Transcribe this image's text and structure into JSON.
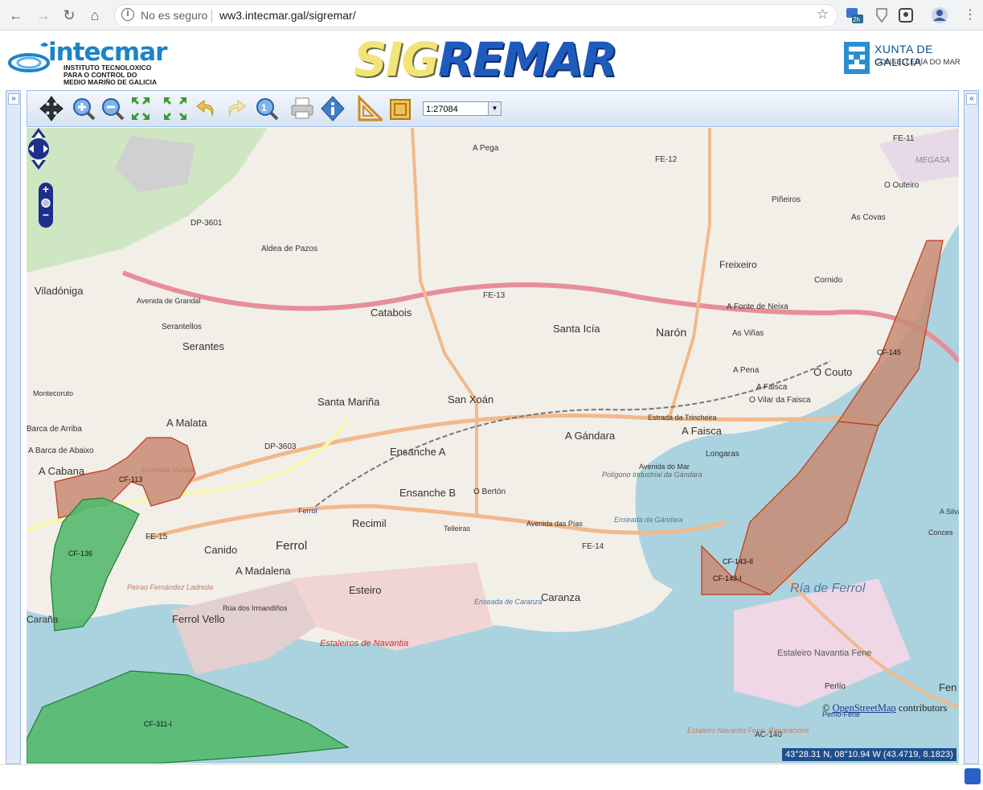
{
  "browser": {
    "security_label": "No es seguro",
    "url": "ww3.intecmar.gal/sigremar/",
    "ext_badge": "2h"
  },
  "header": {
    "intecmar_title": "intecmar",
    "intecmar_subtitle_1": "INSTITUTO TECNOLOXICO",
    "intecmar_subtitle_2": "PARA O CONTROL DO",
    "intecmar_subtitle_3": "MEDIO MARIÑO DE GALICIA",
    "app_title_a": "SIG",
    "app_title_b": "REMAR",
    "xunta_title": "XUNTA DE GALICIA",
    "xunta_subtitle": "CONSELLERÍA DO MAR"
  },
  "toolbar": {
    "scale_value": "1:27084",
    "tools": [
      "pan-tool",
      "zoom-in-tool",
      "zoom-out-tool",
      "zoom-extent-tool",
      "undo-tool",
      "redo-tool",
      "zoom-scale-tool",
      "print-tool",
      "info-tool",
      "measure-tool",
      "measure-area-tool"
    ]
  },
  "map": {
    "attribution_prefix": "©",
    "attribution_link": "OpenStreetMap",
    "attribution_suffix": "contributors",
    "coordinates": "43°28.31 N, 08°10.94 W (43.4719, 8.1823)",
    "zones": [
      {
        "id": "CF-113",
        "color": "#c88a73"
      },
      {
        "id": "CF-136",
        "color": "#55b96e"
      },
      {
        "id": "CF-311-I",
        "color": "#55b96e"
      },
      {
        "id": "CF-145",
        "color": "#c88a73"
      },
      {
        "id": "CF-143-II",
        "color": "#c88a73"
      },
      {
        "id": "CF-143-I",
        "color": "#c88a73"
      }
    ],
    "place_labels": {
      "a_pega": "A Pega",
      "fe12": "FE-12",
      "fe11": "FE-11",
      "megasa": "MEGASA",
      "o_outeiro": "O Outeiro",
      "pineiros": "Piñeiros",
      "as_covas": "As Covas",
      "dp3601": "DP-3601",
      "aldea_pazos": "Aldea de Pazos",
      "freixeiro": "Freixeiro",
      "cornido": "Cornido",
      "viladonga": "Viladóniga",
      "avenida_grandal": "Avenida de Grandal",
      "fe13": "FE-13",
      "catabois": "Catabois",
      "a_fonte_neixa": "A Fonte de Neixa",
      "serantellos": "Serantellos",
      "santa_icia": "Santa Icía",
      "naron": "Narón",
      "as_vinas": "As Viñas",
      "serantes": "Serantes",
      "o_couto": "O Couto",
      "a_pena": "A Pena",
      "a_faisca": "A Faisca",
      "o_vilar_faisca": "O Vilar da Faisca",
      "montecoruto": "Montecoruto",
      "santa_marina": "Santa Mariña",
      "san_xoan": "San Xoán",
      "a_malata": "A Malata",
      "barca_arriba": "Barca de Arriba",
      "estrada_trincheira": "Estrada da Trincheira",
      "a_gandara": "A Gándara",
      "a_faisca_big": "A Faisca",
      "a_barca_abaixo": "A Barca de Abaixo",
      "dp3603": "DP-3603",
      "ensanche_a": "Ensanche A",
      "longaras": "Longaras",
      "a_cabana": "A Cabana",
      "enseada_malata": "Enseada Malata",
      "avenida_mar": "Avenida do Mar",
      "ensanche_b": "Ensanche B",
      "o_berton": "O Bertón",
      "poligono_gandara": "Polígono Industrial da Gándara",
      "ferrol_station": "Ferrol",
      "recimil": "Recimil",
      "telleiras": "Telleiras",
      "avenida_pias": "Avenida das Pías",
      "fe15": "FE-15",
      "fe14": "FE-14",
      "enseada_gandara": "Enseada da Gándara",
      "canido": "Canido",
      "ferrol": "Ferrol",
      "ria_ferrol": "Ría de Ferrol",
      "a_madalena": "A Madalena",
      "esteiro": "Esteiro",
      "caranza": "Caranza",
      "perlo_fernandez": "Peirao Fernández Ladreda",
      "ferrol_vello": "Ferrol Vello",
      "enseada_caranza": "Enseada de Caranza",
      "estaleiros_navantia": "Estaleiros de Navantia",
      "estaleiro_fene": "Estaleiro Navantia Fene",
      "perlio": "Perlío",
      "perlio_fene": "Perlío-Fene",
      "ac140": "AC-140",
      "fene": "Fen",
      "a_silva": "A Silva",
      "conces": "Conces",
      "estaleiro_reparacions": "Estaleiro Navantia Fene: Reparacións",
      "rua_irmandinos": "Rúa dos Irmandiños",
      "arana": "Caraña"
    }
  }
}
